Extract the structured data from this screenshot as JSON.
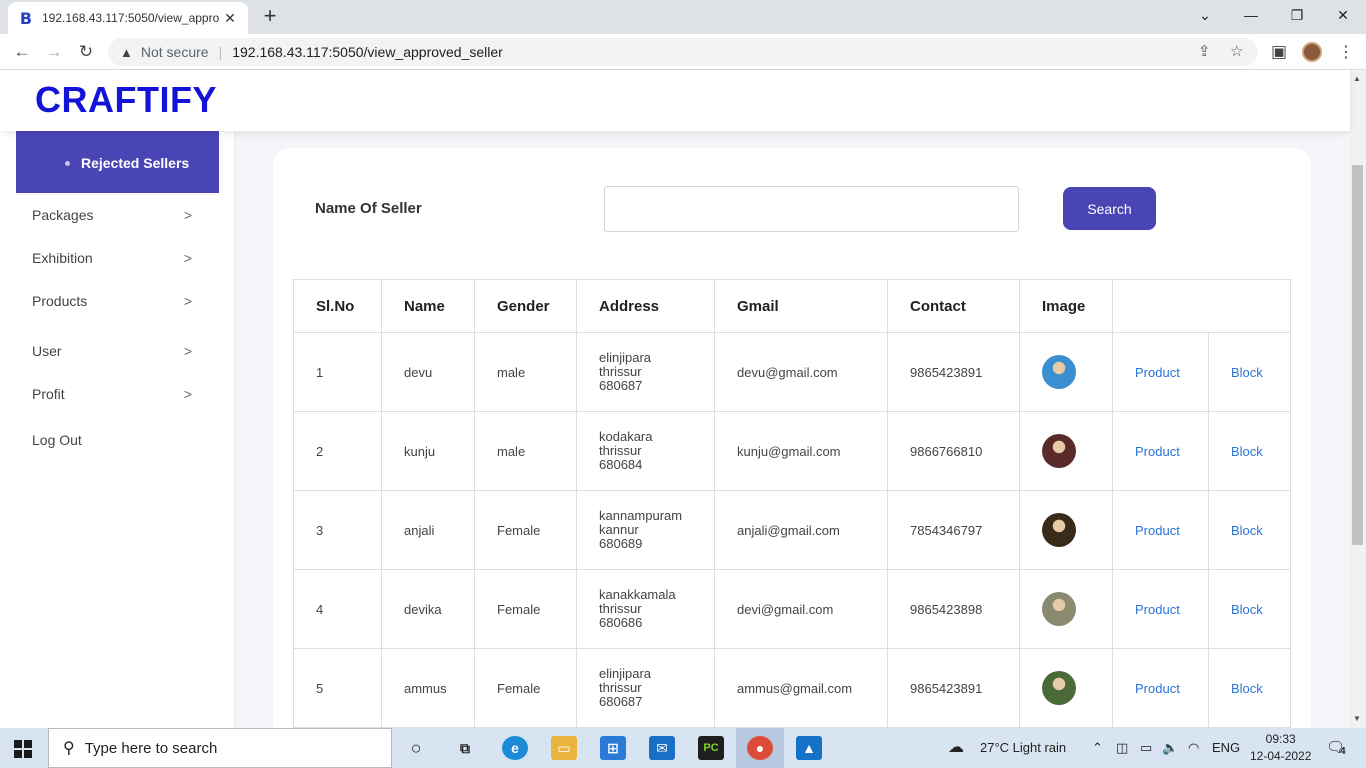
{
  "browser": {
    "tab_title": "192.168.43.117:5050/view_appro",
    "tab_favicon": "B",
    "close_glyph": "✕",
    "new_tab_glyph": "+",
    "security_label": "Not secure",
    "url": "192.168.43.117:5050/view_approved_seller"
  },
  "site": {
    "brand": "CRAFTIFY"
  },
  "sidebar": {
    "submenu_item": "Rejected Sellers",
    "items": [
      {
        "label": "Packages",
        "chevron": true
      },
      {
        "label": "Exhibition",
        "chevron": true
      },
      {
        "label": "Products",
        "chevron": true
      },
      {
        "label": "User",
        "chevron": true
      },
      {
        "label": "Profit",
        "chevron": true
      },
      {
        "label": "Log Out",
        "chevron": false
      }
    ]
  },
  "search": {
    "label": "Name Of Seller",
    "value": "",
    "button": "Search"
  },
  "table": {
    "headers": [
      "Sl.No",
      "Name",
      "Gender",
      "Address",
      "Gmail",
      "Contact",
      "Image",
      ""
    ],
    "action_product": "Product",
    "action_block": "Block",
    "rows": [
      {
        "sl": "1",
        "name": "devu",
        "gender": "male",
        "addr1": "elinjipara",
        "addr2": "thrissur",
        "addr3": "680687",
        "gmail": "devu@gmail.com",
        "contact": "9865423891",
        "img_color": "#3a8fd0"
      },
      {
        "sl": "2",
        "name": "kunju",
        "gender": "male",
        "addr1": "kodakara",
        "addr2": "thrissur",
        "addr3": "680684",
        "gmail": "kunju@gmail.com",
        "contact": "9866766810",
        "img_color": "#5a2a2a"
      },
      {
        "sl": "3",
        "name": "anjali",
        "gender": "Female",
        "addr1": "kannampuram",
        "addr2": "kannur",
        "addr3": "680689",
        "gmail": "anjali@gmail.com",
        "contact": "7854346797",
        "img_color": "#3a2a1a"
      },
      {
        "sl": "4",
        "name": "devika",
        "gender": "Female",
        "addr1": "kanakkamala",
        "addr2": "thrissur",
        "addr3": "680686",
        "gmail": "devi@gmail.com",
        "contact": "9865423898",
        "img_color": "#8a8a70"
      },
      {
        "sl": "5",
        "name": "ammus",
        "gender": "Female",
        "addr1": "elinjipara",
        "addr2": "thrissur",
        "addr3": "680687",
        "gmail": "ammus@gmail.com",
        "contact": "9865423891",
        "img_color": "#4a6a3a"
      }
    ]
  },
  "taskbar": {
    "search_placeholder": "Type here to search",
    "weather": "27°C  Light rain",
    "language": "ENG",
    "time": "09:33",
    "date": "12-04-2022",
    "notifications": "4"
  }
}
